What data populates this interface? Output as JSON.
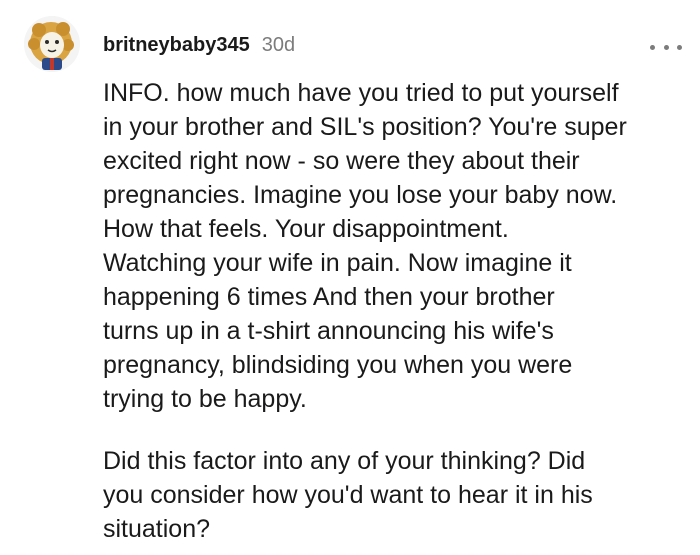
{
  "comment": {
    "username": "britneybaby345",
    "age": "30d",
    "more_icon": "more-horizontal-icon",
    "avatar_icon": "lion-avatar-icon",
    "paragraphs": [
      "INFO. how much have you tried to put yourself\nin your brother and SIL's position? You're super\nexcited right now - so were they about their\npregnancies. Imagine you lose your baby now.\nHow that feels. Your disappointment.\nWatching your wife in pain. Now imagine it\nhappening 6 times And then your brother\nturns up in a t-shirt announcing his wife's\npregnancy, blindsiding you when you were\ntrying to be happy.",
      "Did this factor into any of your thinking? Did\nyou consider how you'd want to hear it in his\nsituation?"
    ]
  },
  "colors": {
    "text": "#1a1a1b",
    "meta": "#7c7c7c",
    "background": "#ffffff",
    "avatar_mane": "#d9a441",
    "avatar_face": "#f7f2e6"
  }
}
